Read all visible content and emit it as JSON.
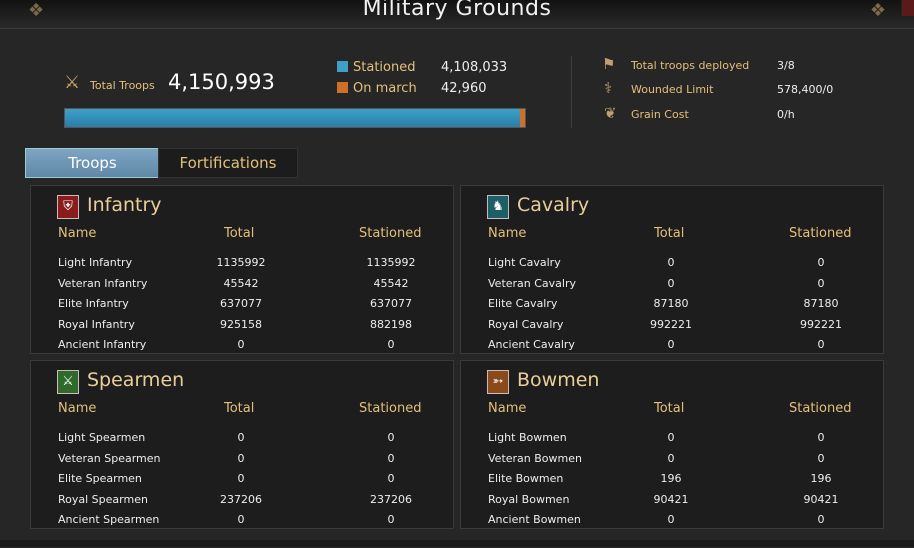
{
  "window": {
    "title": "Military Grounds"
  },
  "summary": {
    "total_label": "Total Troops",
    "total_value": "4,150,993",
    "stationed_label": "Stationed",
    "stationed_value": "4,108,033",
    "on_march_label": "On march",
    "on_march_value": "42,960",
    "stationed_color": "#3ea0c8",
    "on_march_color": "#d07028",
    "stationed_fraction": 0.9897
  },
  "info": [
    {
      "label": "Total troops deployed",
      "value": "3/8",
      "icon": "flag-icon"
    },
    {
      "label": "Wounded Limit",
      "value": "578,400/0",
      "icon": "medicine-bag-icon"
    },
    {
      "label": "Grain Cost",
      "value": "0/h",
      "icon": "grain-icon"
    }
  ],
  "tabs": {
    "troops": "Troops",
    "fortifications": "Fortifications"
  },
  "columns": {
    "name": "Name",
    "total": "Total",
    "stationed": "Stationed"
  },
  "cards": [
    {
      "title": "Infantry",
      "icon": "shield-icon",
      "color": "#8a1c1c",
      "rows": [
        {
          "name": "Light Infantry",
          "total": "1135992",
          "stationed": "1135992"
        },
        {
          "name": "Veteran Infantry",
          "total": "45542",
          "stationed": "45542"
        },
        {
          "name": "Elite Infantry",
          "total": "637077",
          "stationed": "637077"
        },
        {
          "name": "Royal Infantry",
          "total": "925158",
          "stationed": "882198"
        },
        {
          "name": "Ancient Infantry",
          "total": "0",
          "stationed": "0"
        }
      ]
    },
    {
      "title": "Cavalry",
      "icon": "horse-icon",
      "color": "#1d5f66",
      "rows": [
        {
          "name": "Light Cavalry",
          "total": "0",
          "stationed": "0"
        },
        {
          "name": "Veteran Cavalry",
          "total": "0",
          "stationed": "0"
        },
        {
          "name": "Elite Cavalry",
          "total": "87180",
          "stationed": "87180"
        },
        {
          "name": "Royal Cavalry",
          "total": "992221",
          "stationed": "992221"
        },
        {
          "name": "Ancient Cavalry",
          "total": "0",
          "stationed": "0"
        }
      ]
    },
    {
      "title": "Spearmen",
      "icon": "crossed-spears-icon",
      "color": "#2f6a2a",
      "rows": [
        {
          "name": "Light Spearmen",
          "total": "0",
          "stationed": "0"
        },
        {
          "name": "Veteran Spearmen",
          "total": "0",
          "stationed": "0"
        },
        {
          "name": "Elite Spearmen",
          "total": "0",
          "stationed": "0"
        },
        {
          "name": "Royal Spearmen",
          "total": "237206",
          "stationed": "237206"
        },
        {
          "name": "Ancient Spearmen",
          "total": "0",
          "stationed": "0"
        }
      ]
    },
    {
      "title": "Bowmen",
      "icon": "bow-icon",
      "color": "#8a4a1c",
      "rows": [
        {
          "name": "Light Bowmen",
          "total": "0",
          "stationed": "0"
        },
        {
          "name": "Veteran Bowmen",
          "total": "0",
          "stationed": "0"
        },
        {
          "name": "Elite Bowmen",
          "total": "196",
          "stationed": "196"
        },
        {
          "name": "Royal Bowmen",
          "total": "90421",
          "stationed": "90421"
        },
        {
          "name": "Ancient Bowmen",
          "total": "0",
          "stationed": "0"
        }
      ]
    }
  ]
}
